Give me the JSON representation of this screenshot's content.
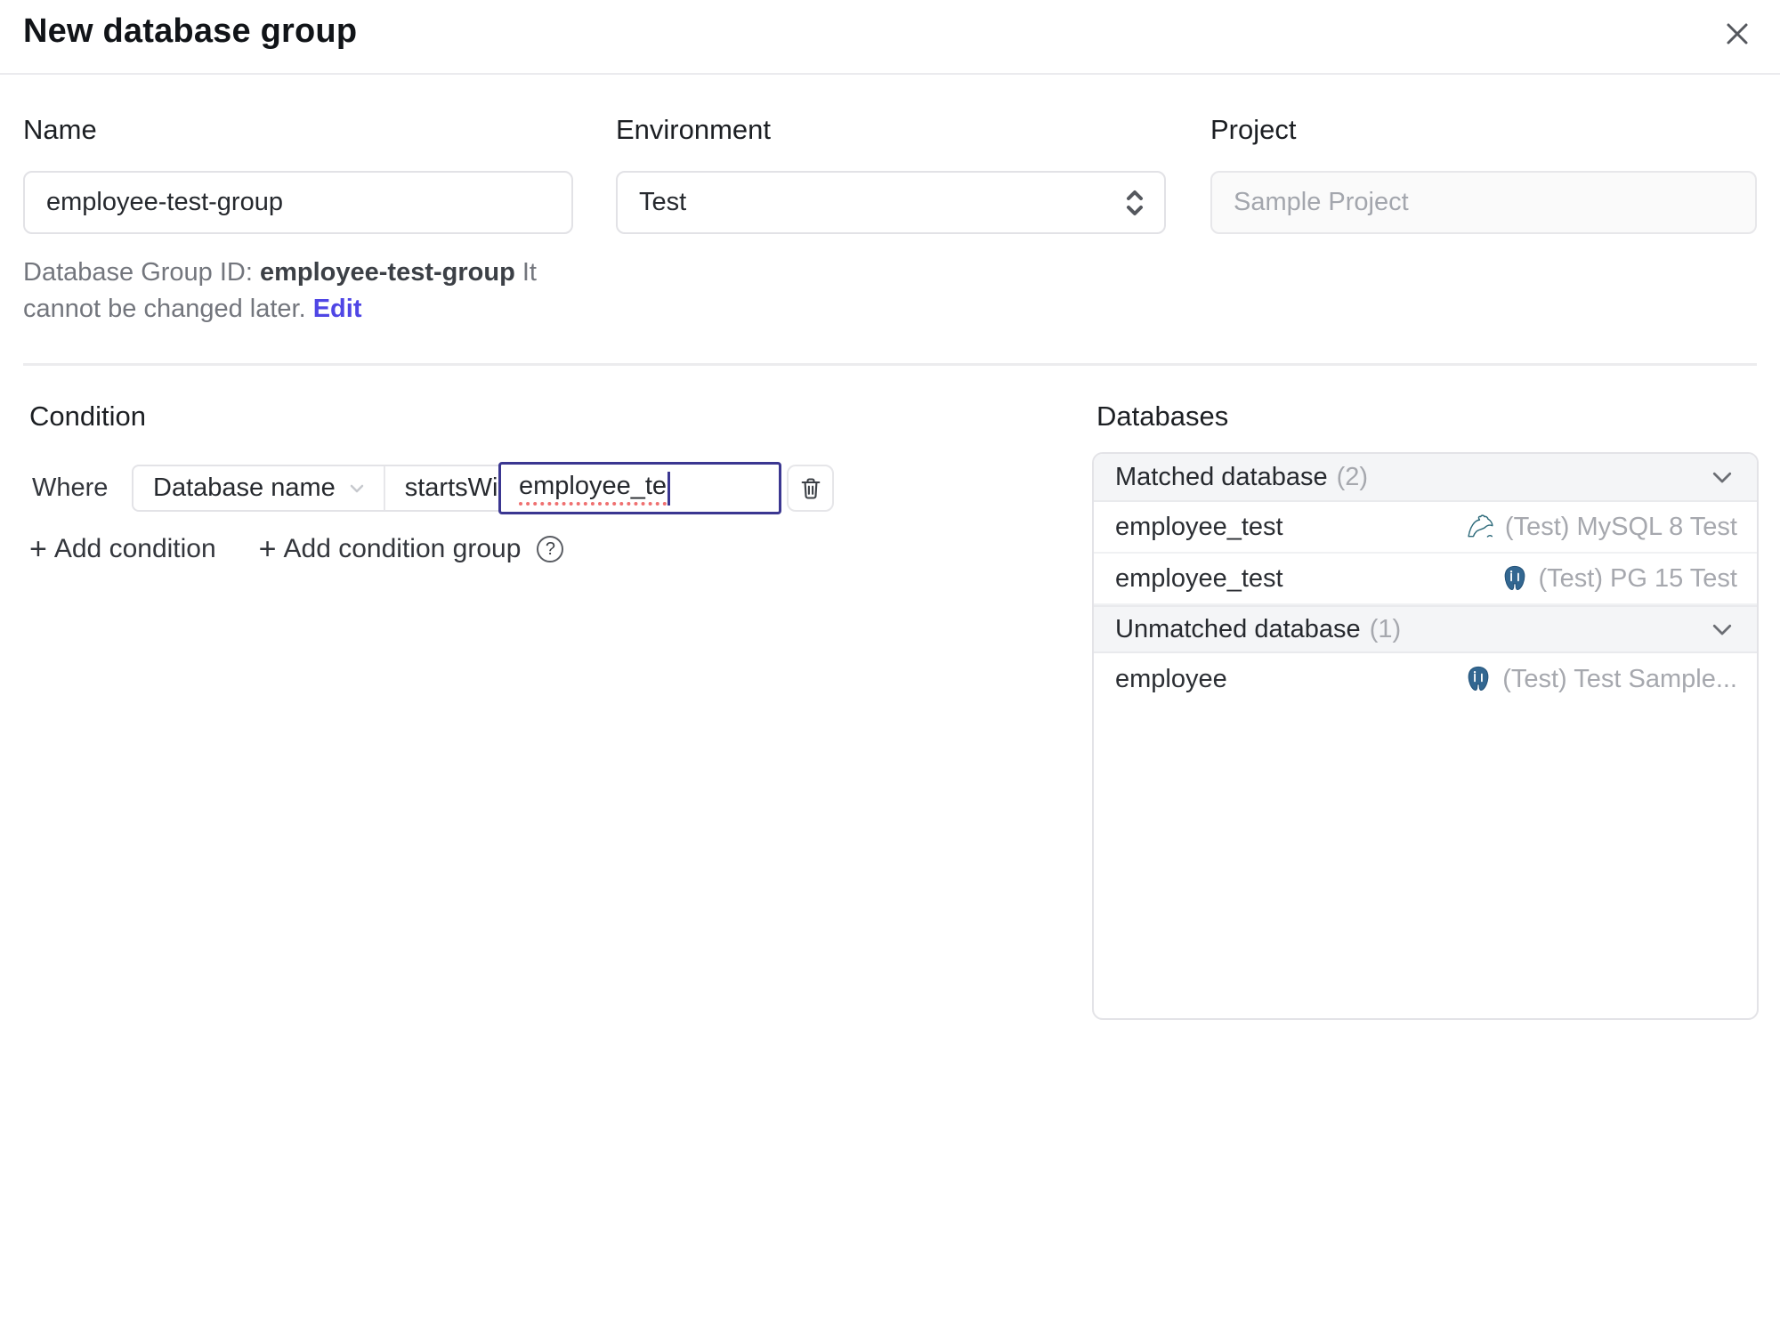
{
  "colors": {
    "accent_indigo": "#4f46e5",
    "focus_border": "#3b3791",
    "mysql_teal": "#2d6a7a",
    "postgres_blue": "#336791",
    "muted_text": "#a6a8ae"
  },
  "header": {
    "title": "New database group"
  },
  "form": {
    "name": {
      "label": "Name",
      "value": "employee-test-group"
    },
    "environment": {
      "label": "Environment",
      "value": "Test"
    },
    "project": {
      "label": "Project",
      "value": "Sample Project"
    },
    "group_id_note": {
      "prefix": "Database Group ID: ",
      "id": "employee-test-group",
      "suffix": " It cannot be changed later. ",
      "edit_label": "Edit"
    }
  },
  "condition": {
    "heading": "Condition",
    "where_label": "Where",
    "field": "Database name",
    "operator": "startsWith",
    "value": "employee_te",
    "add_condition": "Add condition",
    "add_condition_group": "Add condition group"
  },
  "databases": {
    "heading": "Databases",
    "groups": [
      {
        "title": "Matched database",
        "count": "(2)",
        "rows": [
          {
            "name": "employee_test",
            "engine": "mysql",
            "instance": "(Test) MySQL 8 Test"
          },
          {
            "name": "employee_test",
            "engine": "postgres",
            "instance": "(Test) PG 15 Test"
          }
        ]
      },
      {
        "title": "Unmatched database",
        "count": "(1)",
        "rows": [
          {
            "name": "employee",
            "engine": "postgres",
            "instance": "(Test) Test Sample..."
          }
        ]
      }
    ]
  },
  "icons": {
    "plus": "+",
    "help": "?"
  }
}
